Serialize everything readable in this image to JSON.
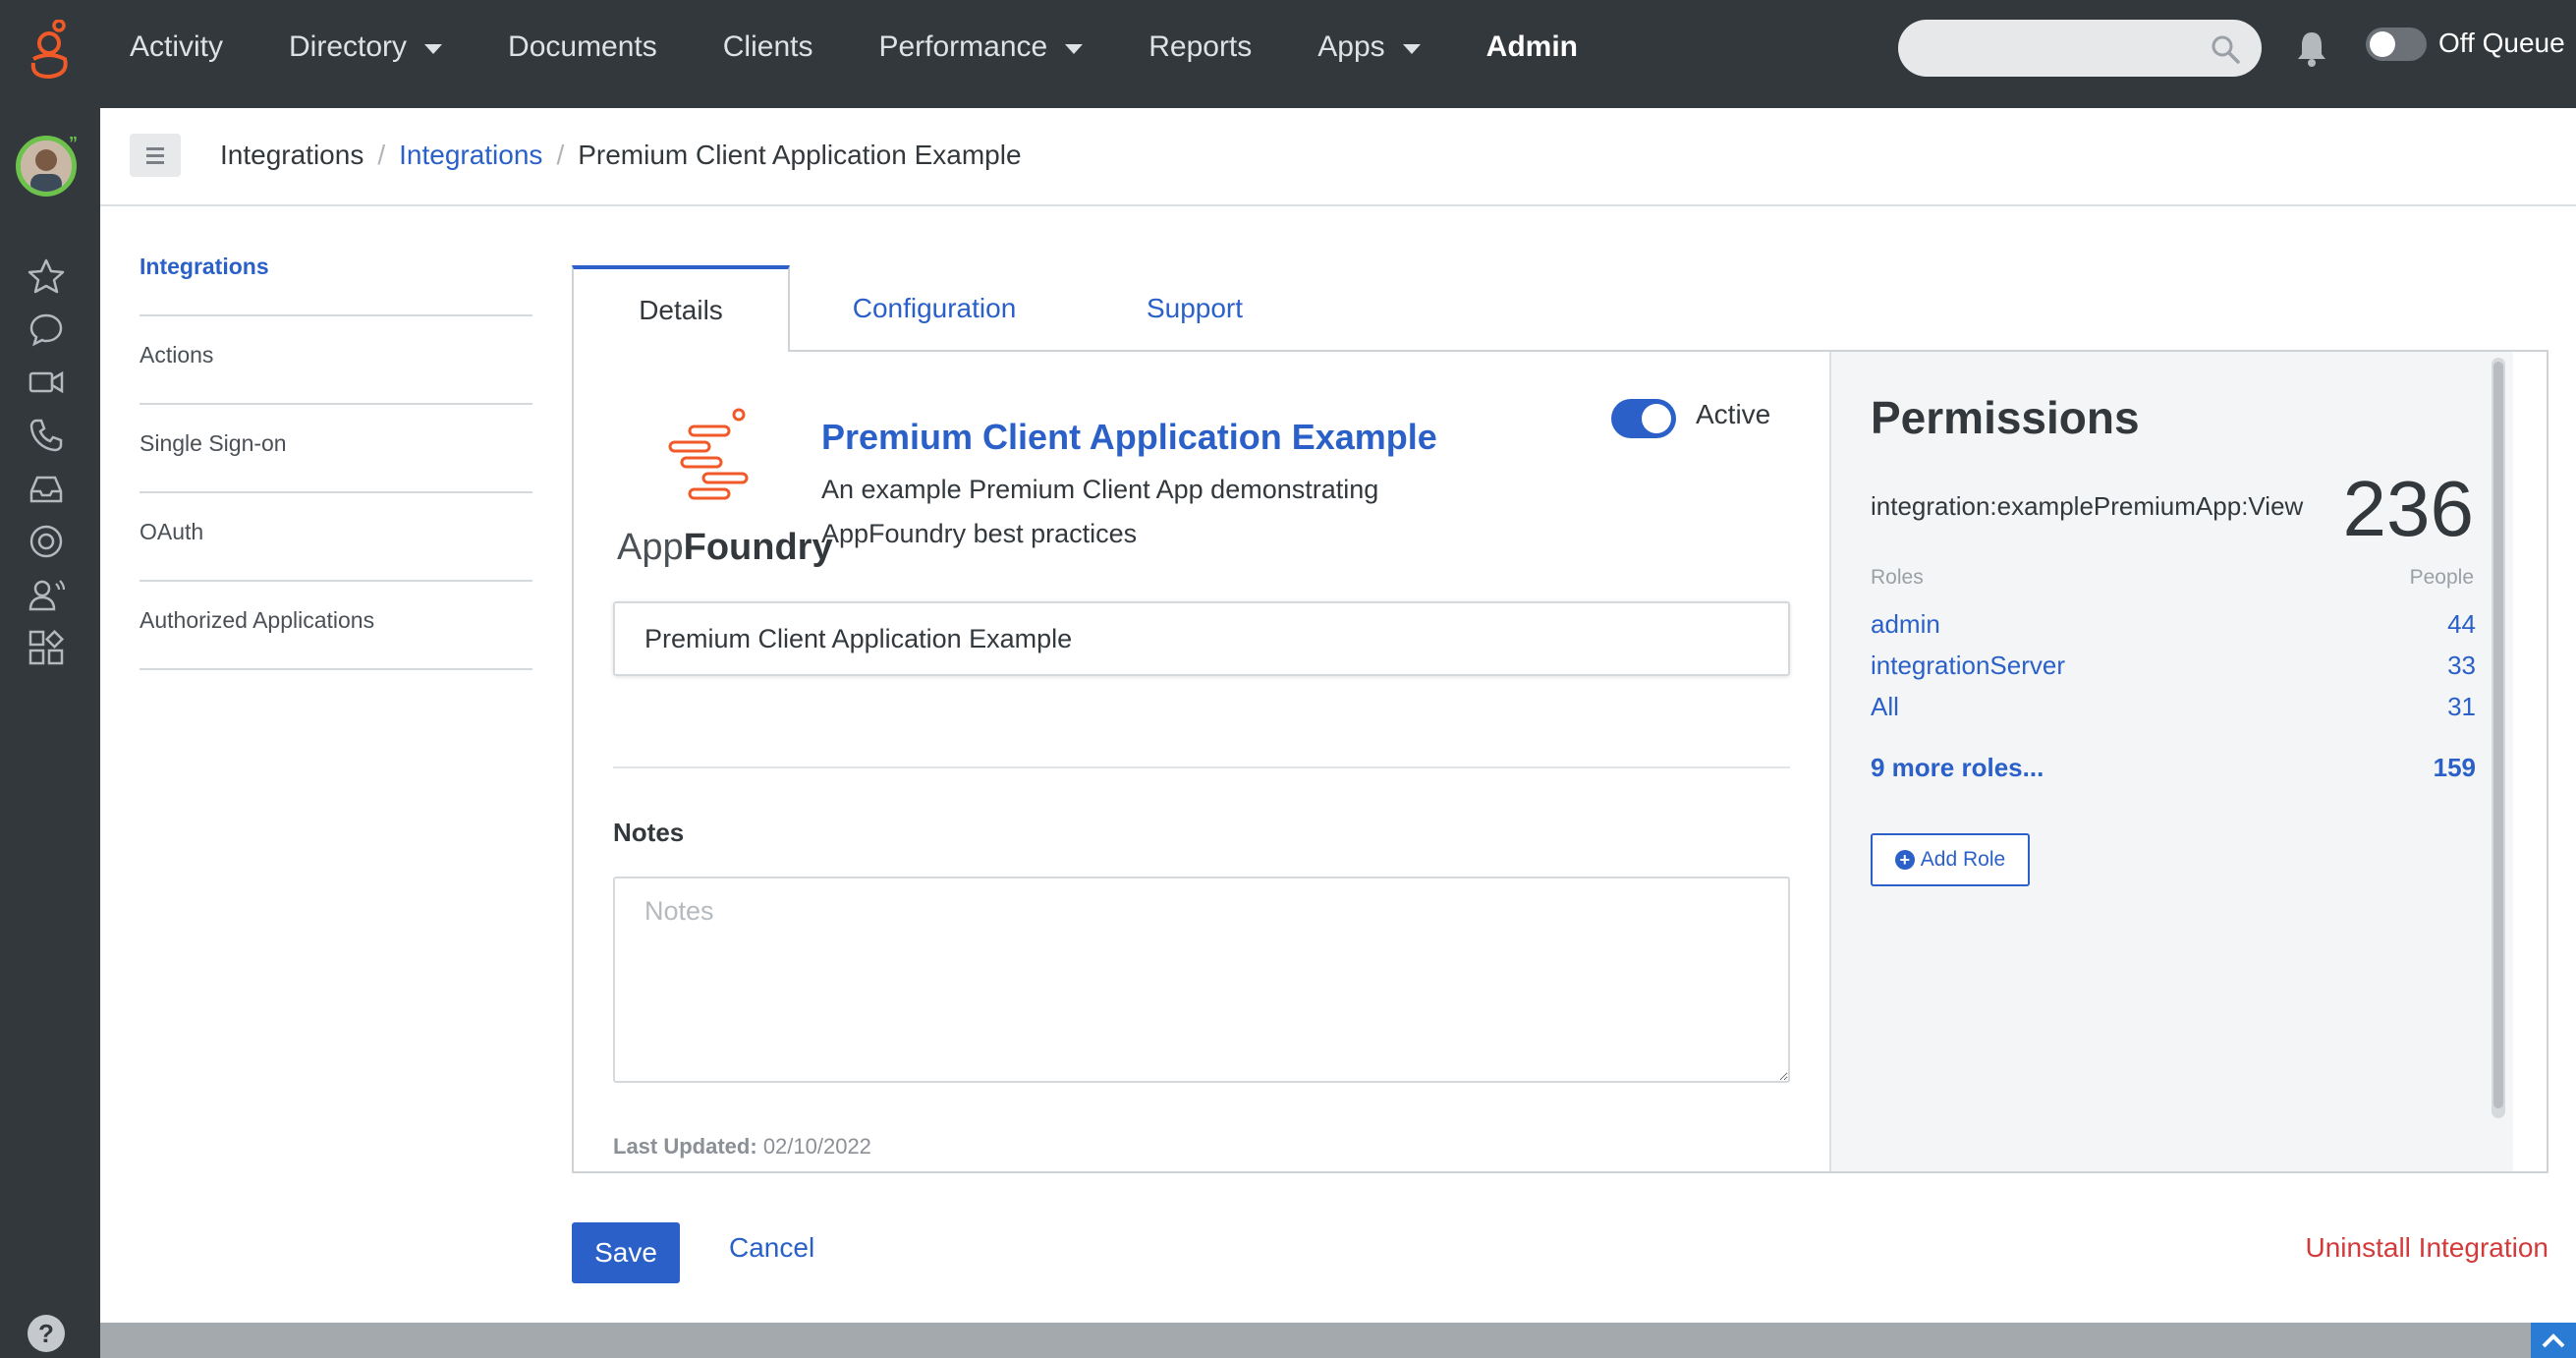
{
  "nav": {
    "items": [
      {
        "label": "Activity",
        "dropdown": false,
        "active": false
      },
      {
        "label": "Directory",
        "dropdown": true,
        "active": false
      },
      {
        "label": "Documents",
        "dropdown": false,
        "active": false
      },
      {
        "label": "Clients",
        "dropdown": false,
        "active": false
      },
      {
        "label": "Performance",
        "dropdown": true,
        "active": false
      },
      {
        "label": "Reports",
        "dropdown": false,
        "active": false
      },
      {
        "label": "Apps",
        "dropdown": true,
        "active": false
      },
      {
        "label": "Admin",
        "dropdown": false,
        "active": true
      }
    ],
    "search_placeholder": "",
    "queue_label": "Off Queue"
  },
  "breadcrumb": {
    "items": [
      "Integrations",
      "Integrations",
      "Premium Client Application Example"
    ]
  },
  "sidemenu": {
    "items": [
      "Integrations",
      "Actions",
      "Single Sign-on",
      "OAuth",
      "Authorized Applications"
    ]
  },
  "tabs": [
    "Details",
    "Configuration",
    "Support"
  ],
  "details": {
    "logo_text_light": "App",
    "logo_text_bold": "Foundry",
    "title": "Premium Client Application Example",
    "description": "An example Premium Client App demonstrating AppFoundry best practices",
    "active_label": "Active",
    "name_value": "Premium Client Application Example",
    "notes_label": "Notes",
    "notes_placeholder": "Notes",
    "last_updated_label": "Last Updated:",
    "last_updated_value": "02/10/2022"
  },
  "permissions": {
    "title": "Permissions",
    "name": "integration:examplePremiumApp:View",
    "count": "236",
    "roles_header": "Roles",
    "people_header": "People",
    "roles": [
      {
        "name": "admin",
        "count": "44"
      },
      {
        "name": "integrationServer",
        "count": "33"
      },
      {
        "name": "All",
        "count": "31"
      }
    ],
    "more_label": "9 more roles...",
    "more_count": "159",
    "add_role_label": "Add Role"
  },
  "actions": {
    "save_label": "Save",
    "cancel_label": "Cancel",
    "uninstall_label": "Uninstall Integration"
  },
  "colors": {
    "accent": "#2a60c8",
    "brand_orange": "#f05a28",
    "danger": "#d33a3a",
    "topbar": "#33383d"
  },
  "icons": {
    "rail": [
      "star-icon",
      "chat-icon",
      "video-icon",
      "phone-icon",
      "inbox-icon",
      "lifebuoy-icon",
      "agent-icon",
      "apps-icon",
      "help-icon"
    ]
  }
}
